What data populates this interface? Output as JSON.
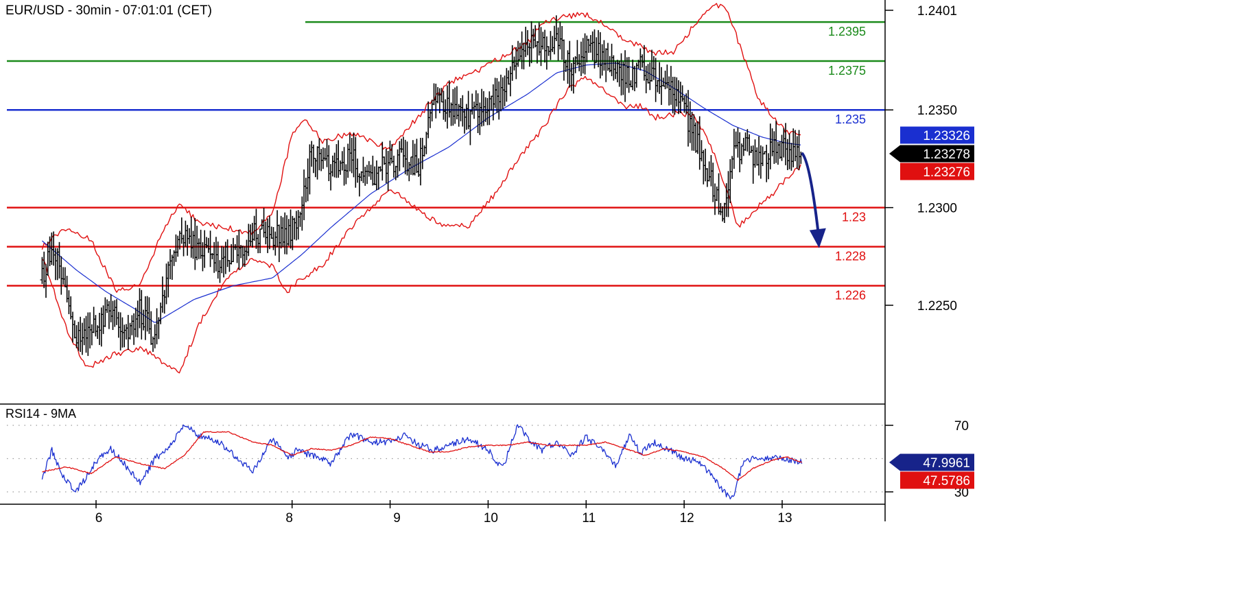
{
  "chart_data": [
    {
      "type": "line",
      "title": "EUR/USD - 30min - 07:01:01 (CET)",
      "ylim": [
        1.221,
        1.2406
      ],
      "xlim": [
        5.45,
        13.75
      ],
      "y_ticks": [
        1.2401,
        1.235,
        1.23,
        1.225
      ],
      "y_tick_labels": [
        "1.2401",
        "1.2350",
        "1.2300",
        "1.2250"
      ],
      "x_ticks": [
        6,
        8,
        9,
        10,
        11,
        12,
        13
      ],
      "x_tick_labels": [
        "6",
        "8",
        "9",
        "10",
        "11",
        "12",
        "13"
      ],
      "grid": false,
      "colors": {
        "resistance": "#1a8a1a",
        "pivot": "#1a2fd0",
        "support": "#e01010",
        "bollinger": "#e01010",
        "moving_average": "#1a2fd0",
        "price": "#000000",
        "forecast_arrow": "#17238a"
      },
      "levels": [
        {
          "value": 1.2395,
          "label": "1.2395",
          "kind": "resistance"
        },
        {
          "value": 1.2375,
          "label": "1.2375",
          "kind": "resistance"
        },
        {
          "value": 1.235,
          "label": "1.235",
          "kind": "pivot"
        },
        {
          "value": 1.23,
          "label": "1.23",
          "kind": "support"
        },
        {
          "value": 1.228,
          "label": "1.228",
          "kind": "support"
        },
        {
          "value": 1.226,
          "label": "1.226",
          "kind": "support"
        }
      ],
      "price_keypoints": {
        "x": [
          5.45,
          5.55,
          5.65,
          5.8,
          6.0,
          6.15,
          6.3,
          6.45,
          6.6,
          6.75,
          6.9,
          7.05,
          7.25,
          7.45,
          7.6,
          7.8,
          7.95,
          8.05,
          8.2,
          8.4,
          8.6,
          8.8,
          9.0,
          9.15,
          9.3,
          9.45,
          9.6,
          9.8,
          10.0,
          10.15,
          10.3,
          10.45,
          10.55,
          10.7,
          10.85,
          11.0,
          11.15,
          11.3,
          11.45,
          11.55,
          11.7,
          11.85,
          12.0,
          12.15,
          12.3,
          12.4,
          12.5,
          12.6,
          12.7,
          12.85,
          13.0,
          13.2
        ],
        "y": [
          1.2263,
          1.228,
          1.2265,
          1.2235,
          1.2238,
          1.225,
          1.2235,
          1.2248,
          1.2232,
          1.2275,
          1.2285,
          1.2278,
          1.2273,
          1.2278,
          1.2286,
          1.2285,
          1.2287,
          1.2292,
          1.233,
          1.2322,
          1.2325,
          1.2315,
          1.2323,
          1.2325,
          1.2322,
          1.236,
          1.2352,
          1.2345,
          1.2353,
          1.236,
          1.2375,
          1.2383,
          1.2385,
          1.2385,
          1.2372,
          1.238,
          1.2378,
          1.2373,
          1.2365,
          1.2372,
          1.2366,
          1.2366,
          1.235,
          1.233,
          1.231,
          1.2298,
          1.2325,
          1.2332,
          1.2327,
          1.2328,
          1.233,
          1.2328
        ]
      },
      "moving_average_keypoints": {
        "x": [
          5.45,
          5.8,
          6.1,
          6.4,
          6.6,
          7.0,
          7.4,
          7.8,
          8.1,
          8.4,
          8.8,
          9.2,
          9.6,
          10.0,
          10.4,
          10.7,
          11.0,
          11.3,
          11.6,
          11.9,
          12.2,
          12.5,
          12.8,
          13.05,
          13.2
        ],
        "y": [
          1.2283,
          1.2268,
          1.2257,
          1.2248,
          1.2241,
          1.2253,
          1.226,
          1.2264,
          1.2276,
          1.229,
          1.2307,
          1.232,
          1.2331,
          1.2346,
          1.2358,
          1.2369,
          1.2373,
          1.2374,
          1.237,
          1.2361,
          1.2351,
          1.2342,
          1.2336,
          1.2333,
          1.2332
        ]
      },
      "bollinger_upper_keypoints": {
        "x": [
          5.45,
          5.7,
          5.95,
          6.2,
          6.45,
          6.7,
          6.85,
          7.05,
          7.3,
          7.6,
          7.8,
          8.0,
          8.15,
          8.3,
          8.6,
          9.0,
          9.4,
          9.6,
          9.9,
          10.2,
          10.4,
          10.55,
          10.8,
          11.0,
          11.2,
          11.4,
          11.55,
          11.7,
          11.9,
          12.1,
          12.3,
          12.45,
          12.6,
          12.75,
          12.9,
          13.05,
          13.2
        ],
        "y": [
          1.228,
          1.229,
          1.2283,
          1.2258,
          1.226,
          1.229,
          1.2302,
          1.2292,
          1.229,
          1.2287,
          1.2297,
          1.2337,
          1.2345,
          1.2334,
          1.2338,
          1.233,
          1.2353,
          1.2364,
          1.237,
          1.2379,
          1.2384,
          1.2394,
          1.2398,
          1.2399,
          1.2393,
          1.2385,
          1.2383,
          1.2379,
          1.238,
          1.2393,
          1.2405,
          1.24,
          1.2378,
          1.2357,
          1.2346,
          1.2339,
          1.2336
        ]
      },
      "bollinger_lower_keypoints": {
        "x": [
          5.45,
          5.7,
          5.9,
          6.2,
          6.45,
          6.65,
          6.85,
          7.05,
          7.3,
          7.6,
          7.8,
          7.95,
          8.1,
          8.3,
          8.6,
          9.0,
          9.3,
          9.5,
          9.8,
          10.1,
          10.35,
          10.55,
          10.8,
          11.0,
          11.2,
          11.4,
          11.55,
          11.7,
          11.9,
          12.1,
          12.3,
          12.45,
          12.55,
          12.7,
          12.9,
          13.05,
          13.2
        ],
        "y": [
          1.2275,
          1.2238,
          1.2218,
          1.2225,
          1.2228,
          1.2222,
          1.2216,
          1.224,
          1.2262,
          1.2274,
          1.227,
          1.2257,
          1.2264,
          1.227,
          1.229,
          1.231,
          1.2298,
          1.2292,
          1.229,
          1.2309,
          1.2328,
          1.234,
          1.236,
          1.2367,
          1.236,
          1.2352,
          1.2352,
          1.2346,
          1.2348,
          1.2348,
          1.2328,
          1.2306,
          1.229,
          1.2298,
          1.2307,
          1.2315,
          1.2322
        ]
      },
      "forecast_arrow": {
        "x": [
          13.2,
          13.37
        ],
        "y": [
          1.2328,
          1.228
        ]
      },
      "price_tags": [
        {
          "value": "1.23326",
          "y": 1.23326,
          "color": "#1a2fd0"
        },
        {
          "value": "1.23278",
          "y": 1.23278,
          "color": "#000000"
        },
        {
          "value": "1.23276",
          "y": 1.23276,
          "color": "#e01010"
        }
      ]
    },
    {
      "type": "line",
      "title": "RSI14 - 9MA",
      "ylim": [
        25,
        85
      ],
      "y_ticks": [
        70,
        30
      ],
      "y_tick_labels": [
        "70",
        "30"
      ],
      "dotted_levels": [
        70,
        50,
        30
      ],
      "series": [
        {
          "color": "#1a2fd0",
          "x": [
            5.45,
            5.55,
            5.65,
            5.8,
            6.0,
            6.15,
            6.3,
            6.45,
            6.6,
            6.75,
            6.9,
            7.05,
            7.25,
            7.45,
            7.6,
            7.8,
            7.95,
            8.05,
            8.2,
            8.4,
            8.6,
            8.8,
            9.0,
            9.15,
            9.3,
            9.45,
            9.6,
            9.8,
            10.0,
            10.15,
            10.3,
            10.45,
            10.55,
            10.7,
            10.85,
            11.0,
            11.15,
            11.3,
            11.45,
            11.55,
            11.7,
            11.85,
            12.0,
            12.15,
            12.3,
            12.4,
            12.5,
            12.6,
            12.7,
            12.85,
            13.0,
            13.2
          ],
          "y": [
            38,
            55,
            40,
            30,
            48,
            56,
            46,
            35,
            50,
            57,
            70,
            64,
            60,
            50,
            42,
            62,
            50,
            55,
            52,
            47,
            65,
            60,
            60,
            64,
            58,
            55,
            58,
            62,
            55,
            44,
            70,
            60,
            55,
            60,
            52,
            63,
            56,
            46,
            65,
            53,
            60,
            55,
            50,
            48,
            38,
            30,
            26,
            48,
            50,
            50,
            50,
            48
          ]
        },
        {
          "color": "#e01010",
          "x": [
            5.45,
            5.7,
            5.95,
            6.2,
            6.45,
            6.7,
            6.9,
            7.1,
            7.35,
            7.6,
            7.8,
            8.0,
            8.2,
            8.4,
            8.6,
            8.8,
            9.0,
            9.2,
            9.4,
            9.6,
            9.8,
            10.0,
            10.2,
            10.4,
            10.6,
            10.8,
            11.0,
            11.2,
            11.4,
            11.6,
            11.8,
            12.0,
            12.2,
            12.4,
            12.55,
            12.7,
            12.9,
            13.05,
            13.2
          ],
          "y": [
            42,
            45,
            41,
            51,
            47,
            44,
            52,
            66,
            66,
            60,
            58,
            52,
            56,
            55,
            58,
            63,
            62,
            58,
            54,
            54,
            57,
            58,
            58,
            60,
            58,
            58,
            58,
            60,
            56,
            52,
            56,
            54,
            51,
            44,
            37,
            44,
            49,
            51,
            47.6
          ]
        }
      ],
      "value_tags": [
        {
          "value": "47.9961",
          "y": 47.9961,
          "color": "#17238a"
        },
        {
          "value": "47.5786",
          "y": 47.5786,
          "color": "#e01010"
        }
      ]
    }
  ]
}
